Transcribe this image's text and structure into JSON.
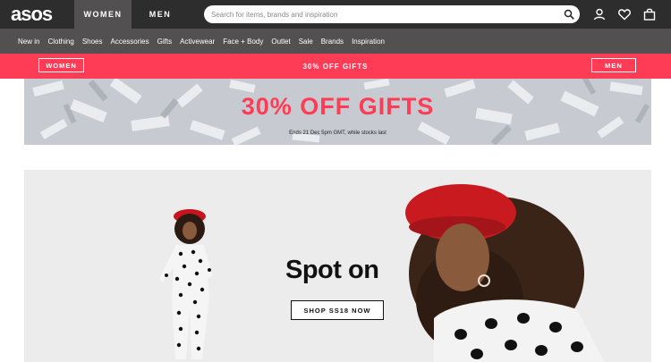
{
  "header": {
    "logo": "asos",
    "tabs": [
      "WOMEN",
      "MEN"
    ],
    "search_placeholder": "Search for items, brands and inspiration",
    "icons": [
      "account-icon",
      "heart-icon",
      "bag-icon"
    ]
  },
  "nav": {
    "items": [
      "New in",
      "Clothing",
      "Shoes",
      "Accessories",
      "Gifts",
      "Activewear",
      "Face + Body",
      "Outlet",
      "Sale",
      "Brands",
      "Inspiration"
    ]
  },
  "promo": {
    "women_label": "WOMEN",
    "center_text": "30% OFF GIFTS",
    "men_label": "MEN"
  },
  "gifts_banner": {
    "title": "30% OFF GIFTS",
    "subtitle": "Ends 21 Dec 5pm GMT, while stocks last"
  },
  "hero": {
    "title": "Spot on",
    "cta": "SHOP SS18 NOW"
  },
  "colors": {
    "topbar": "#2d2d2d",
    "nav": "#525050",
    "accent": "#ff3c55"
  }
}
